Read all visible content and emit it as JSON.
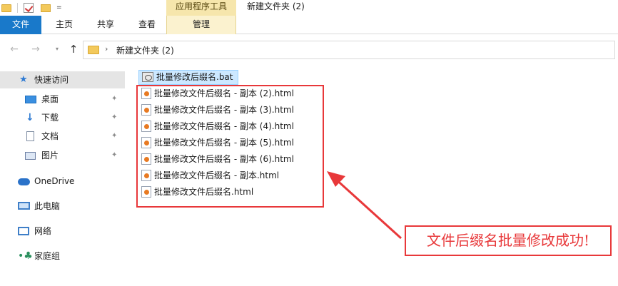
{
  "titlebar": {
    "context_tab_title": "应用程序工具",
    "window_title": "新建文件夹 (2)",
    "qat_drop": "="
  },
  "ribbon": {
    "tabs": [
      {
        "label": "文件"
      },
      {
        "label": "主页"
      },
      {
        "label": "共享"
      },
      {
        "label": "查看"
      },
      {
        "label": "管理"
      }
    ]
  },
  "address": {
    "path": "新建文件夹 (2)"
  },
  "navpane": {
    "items": [
      {
        "label": "快速访问",
        "icon": "star-icon"
      },
      {
        "label": "桌面",
        "icon": "desktop-icon",
        "pinned": true
      },
      {
        "label": "下载",
        "icon": "download-icon",
        "pinned": true
      },
      {
        "label": "文档",
        "icon": "document-icon",
        "pinned": true
      },
      {
        "label": "图片",
        "icon": "pictures-icon",
        "pinned": true
      },
      {
        "label": "OneDrive",
        "icon": "cloud-icon"
      },
      {
        "label": "此电脑",
        "icon": "computer-icon"
      },
      {
        "label": "网络",
        "icon": "network-icon"
      },
      {
        "label": "家庭组",
        "icon": "homegroup-icon"
      }
    ]
  },
  "files": [
    {
      "name": "批量修改后缀名.bat",
      "type": "bat"
    },
    {
      "name": "批量修改文件后缀名 - 副本 (2).html",
      "type": "html"
    },
    {
      "name": "批量修改文件后缀名 - 副本 (3).html",
      "type": "html"
    },
    {
      "name": "批量修改文件后缀名 - 副本 (4).html",
      "type": "html"
    },
    {
      "name": "批量修改文件后缀名 - 副本 (5).html",
      "type": "html"
    },
    {
      "name": "批量修改文件后缀名 - 副本 (6).html",
      "type": "html"
    },
    {
      "name": "批量修改文件后缀名 - 副本.html",
      "type": "html"
    },
    {
      "name": "批量修改文件后缀名.html",
      "type": "html"
    }
  ],
  "callout": {
    "text": "文件后缀名批量修改成功!"
  },
  "colors": {
    "accent": "#1979ca",
    "annotation": "#e8383a",
    "context_tab": "#f6e6ac",
    "selection": "#cce8ff"
  }
}
